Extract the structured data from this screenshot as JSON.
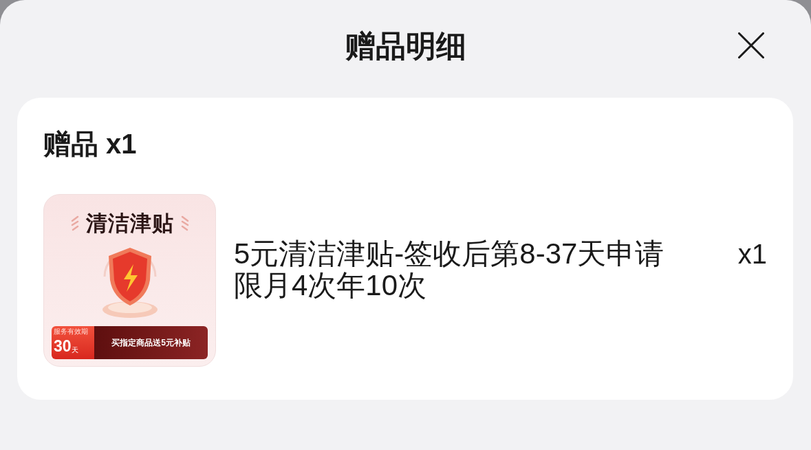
{
  "header": {
    "title": "赠品明细"
  },
  "gift_card": {
    "heading": "赠品 x1",
    "items": [
      {
        "image": {
          "title": "清洁津贴",
          "badge_label": "服务有效期",
          "badge_value": "30",
          "badge_unit": "天",
          "banner": "买指定商品送5元补贴"
        },
        "description": "5元清洁津贴-签收后第8-37天申请限月4次年10次",
        "quantity": "x1"
      }
    ]
  }
}
